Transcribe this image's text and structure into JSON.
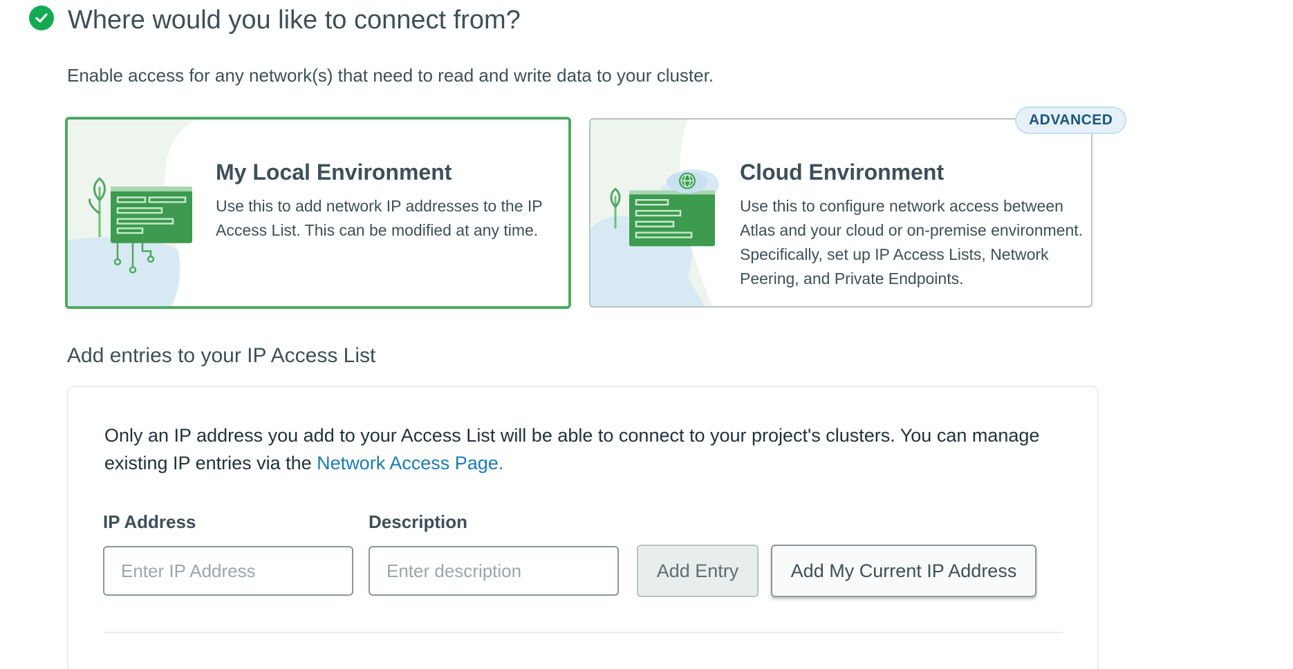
{
  "step": {
    "title": "Where would you like to connect from?",
    "status_icon": "check-circle-icon",
    "subtitle": "Enable access for any network(s) that need to read and write data to your cluster."
  },
  "options": {
    "local": {
      "title": "My Local Environment",
      "description": "Use this to add network IP addresses to the IP Access List. This can be modified at any time.",
      "selected": true
    },
    "cloud": {
      "badge": "ADVANCED",
      "title": "Cloud Environment",
      "description": "Use this to configure network access between Atlas and your cloud or on-premise environment. Specifically, set up IP Access Lists, Network Peering, and Private Endpoints.",
      "selected": false
    }
  },
  "access_list": {
    "section_title": "Add entries to your IP Access List",
    "info_text": "Only an IP address you add to your Access List will be able to connect to your project's clusters. You can manage existing IP entries via the ",
    "info_link": "Network Access Page.",
    "ip_label": "IP Address",
    "ip_placeholder": "Enter IP Address",
    "ip_value": "",
    "description_label": "Description",
    "description_placeholder": "Enter description",
    "description_value": "",
    "add_entry_button": "Add Entry",
    "add_current_ip_button": "Add My Current IP Address"
  },
  "colors": {
    "accent_green": "#13aa52",
    "selected_border": "#4ea862",
    "link_blue": "#1a7ab6",
    "badge_text": "#1a567e"
  }
}
